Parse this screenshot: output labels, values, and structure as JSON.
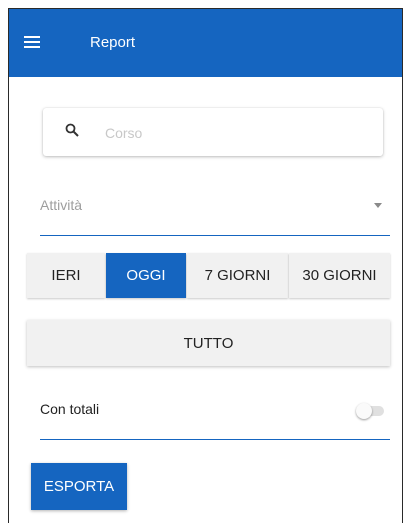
{
  "appbar": {
    "title": "Report",
    "menu_icon": "menu-icon"
  },
  "search": {
    "placeholder": "Corso",
    "value": "",
    "icon": "search-icon"
  },
  "activity_select": {
    "label": "Attività",
    "icon": "dropdown-arrow-icon"
  },
  "period": {
    "options": [
      {
        "label": "IERI",
        "selected": false
      },
      {
        "label": "OGGI",
        "selected": true
      },
      {
        "label": "7 GIORNI",
        "selected": false
      },
      {
        "label": "30 GIORNI",
        "selected": false
      }
    ],
    "all_label": "TUTTO"
  },
  "totals": {
    "label": "Con totali",
    "enabled": false
  },
  "export": {
    "label": "ESPORTA"
  },
  "colors": {
    "primary": "#1565c0",
    "button_bg": "#f1f1f1"
  }
}
